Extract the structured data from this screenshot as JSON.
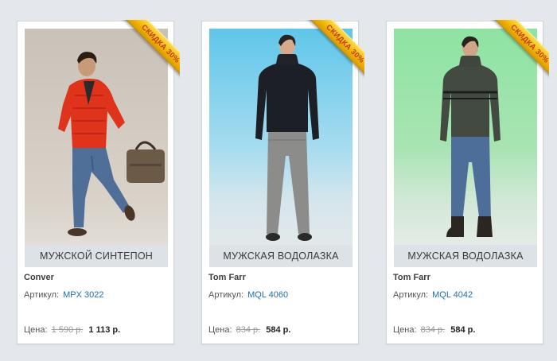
{
  "products": [
    {
      "badge": "СКИДКА 30%",
      "title": "МУЖСКОЙ СИНТЕПОН",
      "brand": "Conver",
      "sku_label": "Артикул:",
      "sku": "MPX 3022",
      "price_label": "Цена:",
      "old_price": "1 590 р.",
      "new_price": "1 113 р."
    },
    {
      "badge": "СКИДКА 30%",
      "title": "МУЖСКАЯ ВОДОЛАЗКА",
      "brand": "Tom Farr",
      "sku_label": "Артикул:",
      "sku": "MQL 4060",
      "price_label": "Цена:",
      "old_price": "834 р.",
      "new_price": "584 р."
    },
    {
      "badge": "СКИДКА 30%",
      "title": "МУЖСКАЯ ВОДОЛАЗКА",
      "brand": "Tom Farr",
      "sku_label": "Артикул:",
      "sku": "MQL 4042",
      "price_label": "Цена:",
      "old_price": "834 р.",
      "new_price": "584 р."
    }
  ],
  "colors": {
    "page_bg": "#e4e8ec",
    "link": "#1f6fa8",
    "badge_text": "#c0392b",
    "badge_bg": "#f0b400"
  }
}
